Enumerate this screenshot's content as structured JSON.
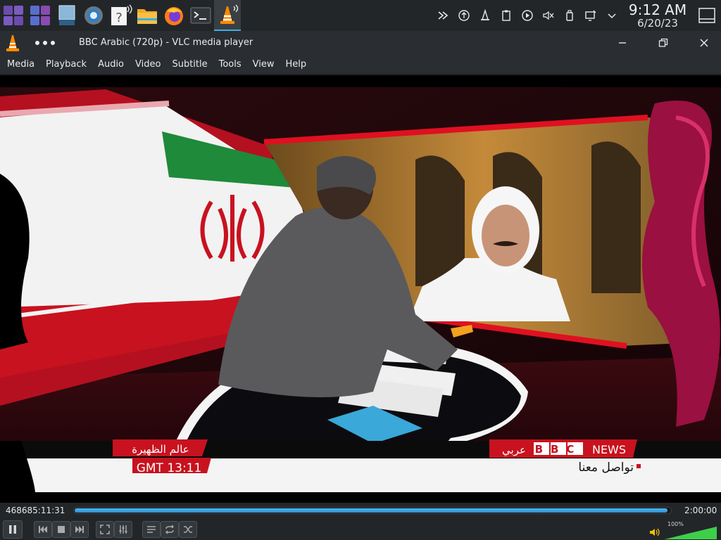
{
  "panel": {
    "tasks": [
      {
        "name": "pager-desktop-1",
        "icon": "desktop-grid-icon"
      },
      {
        "name": "pager-desktop-2",
        "icon": "desktop-grid-icon"
      },
      {
        "name": "show-desktop-app",
        "icon": "window-icon"
      },
      {
        "name": "system-settings",
        "icon": "gear-icon"
      },
      {
        "name": "help-center",
        "icon": "help-icon"
      },
      {
        "name": "file-manager",
        "icon": "folder-icon"
      },
      {
        "name": "firefox",
        "icon": "firefox-icon"
      },
      {
        "name": "terminal",
        "icon": "terminal-icon"
      },
      {
        "name": "vlc-media-player",
        "icon": "vlc-icon"
      }
    ],
    "tray": [
      "kde-connect-icon",
      "update-icon",
      "vlc-tray-icon",
      "clipboard-icon",
      "media-player-icon",
      "volume-muted-icon",
      "device-notifier-icon",
      "network-icon",
      "expand-tray-icon"
    ],
    "clock": {
      "time": "9:12 AM",
      "date": "6/20/23"
    }
  },
  "window": {
    "title": "BBC Arabic (720p) - VLC media player",
    "menu": [
      "Media",
      "Playback",
      "Audio",
      "Video",
      "Subtitle",
      "Tools",
      "View",
      "Help"
    ]
  },
  "video": {
    "ticker_left_1": "عالم الظهيرة",
    "ticker_left_2": "GMT 13:11",
    "ticker_brand": "BBC",
    "ticker_news": "NEWS",
    "ticker_arabic": "عربي",
    "ticker_caption": "تواصل معنا"
  },
  "controls": {
    "elapsed": "468685:11:31",
    "total": "2:00:00",
    "progress": 0.995,
    "volume_label": "100%",
    "volume": 1.0,
    "accent": "#3daee9"
  }
}
